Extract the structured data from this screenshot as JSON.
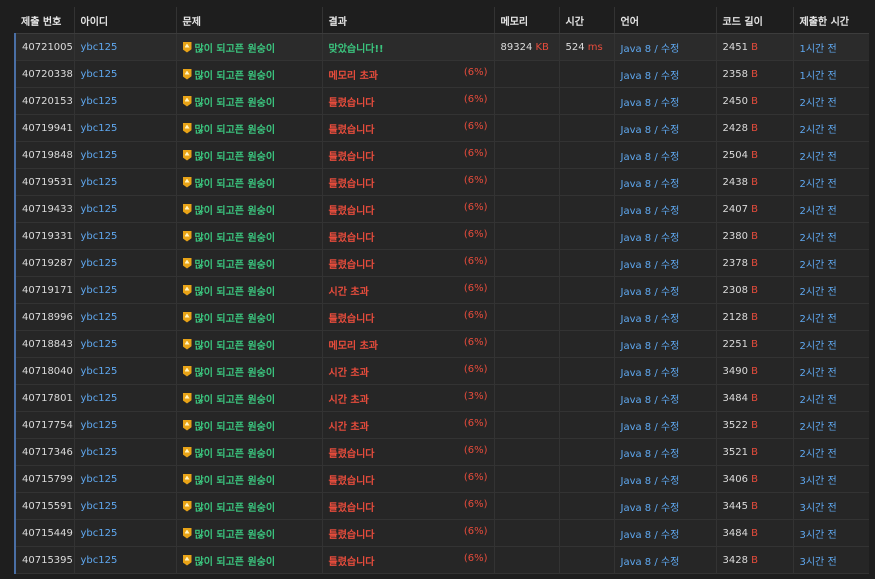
{
  "headers": [
    "제출 번호",
    "아이디",
    "문제",
    "결과",
    "메모리",
    "시간",
    "언어",
    "코드 길이",
    "제출한 시간"
  ],
  "units": {
    "memory": "KB",
    "time": "ms",
    "code": "B"
  },
  "rows": [
    {
      "id": "40721005",
      "user": "ybc125",
      "problem": "많이 되고픈 원숭이",
      "result": "맞았습니다!!",
      "pct": "",
      "ok": true,
      "memory": "89324",
      "time": "524",
      "lang": "Java 8",
      "edit": "수정",
      "length": "2451",
      "when": "1시간 전"
    },
    {
      "id": "40720338",
      "user": "ybc125",
      "problem": "많이 되고픈 원숭이",
      "result": "메모리 초과",
      "pct": "(6%)",
      "ok": false,
      "memory": "",
      "time": "",
      "lang": "Java 8",
      "edit": "수정",
      "length": "2358",
      "when": "1시간 전"
    },
    {
      "id": "40720153",
      "user": "ybc125",
      "problem": "많이 되고픈 원숭이",
      "result": "틀렸습니다",
      "pct": "(6%)",
      "ok": false,
      "memory": "",
      "time": "",
      "lang": "Java 8",
      "edit": "수정",
      "length": "2450",
      "when": "2시간 전"
    },
    {
      "id": "40719941",
      "user": "ybc125",
      "problem": "많이 되고픈 원숭이",
      "result": "틀렸습니다",
      "pct": "(6%)",
      "ok": false,
      "memory": "",
      "time": "",
      "lang": "Java 8",
      "edit": "수정",
      "length": "2428",
      "when": "2시간 전"
    },
    {
      "id": "40719848",
      "user": "ybc125",
      "problem": "많이 되고픈 원숭이",
      "result": "틀렸습니다",
      "pct": "(6%)",
      "ok": false,
      "memory": "",
      "time": "",
      "lang": "Java 8",
      "edit": "수정",
      "length": "2504",
      "when": "2시간 전"
    },
    {
      "id": "40719531",
      "user": "ybc125",
      "problem": "많이 되고픈 원숭이",
      "result": "틀렸습니다",
      "pct": "(6%)",
      "ok": false,
      "memory": "",
      "time": "",
      "lang": "Java 8",
      "edit": "수정",
      "length": "2438",
      "when": "2시간 전"
    },
    {
      "id": "40719433",
      "user": "ybc125",
      "problem": "많이 되고픈 원숭이",
      "result": "틀렸습니다",
      "pct": "(6%)",
      "ok": false,
      "memory": "",
      "time": "",
      "lang": "Java 8",
      "edit": "수정",
      "length": "2407",
      "when": "2시간 전"
    },
    {
      "id": "40719331",
      "user": "ybc125",
      "problem": "많이 되고픈 원숭이",
      "result": "틀렸습니다",
      "pct": "(6%)",
      "ok": false,
      "memory": "",
      "time": "",
      "lang": "Java 8",
      "edit": "수정",
      "length": "2380",
      "when": "2시간 전"
    },
    {
      "id": "40719287",
      "user": "ybc125",
      "problem": "많이 되고픈 원숭이",
      "result": "틀렸습니다",
      "pct": "(6%)",
      "ok": false,
      "memory": "",
      "time": "",
      "lang": "Java 8",
      "edit": "수정",
      "length": "2378",
      "when": "2시간 전"
    },
    {
      "id": "40719171",
      "user": "ybc125",
      "problem": "많이 되고픈 원숭이",
      "result": "시간 초과",
      "pct": "(6%)",
      "ok": false,
      "memory": "",
      "time": "",
      "lang": "Java 8",
      "edit": "수정",
      "length": "2308",
      "when": "2시간 전"
    },
    {
      "id": "40718996",
      "user": "ybc125",
      "problem": "많이 되고픈 원숭이",
      "result": "틀렸습니다",
      "pct": "(6%)",
      "ok": false,
      "memory": "",
      "time": "",
      "lang": "Java 8",
      "edit": "수정",
      "length": "2128",
      "when": "2시간 전"
    },
    {
      "id": "40718843",
      "user": "ybc125",
      "problem": "많이 되고픈 원숭이",
      "result": "메모리 초과",
      "pct": "(6%)",
      "ok": false,
      "memory": "",
      "time": "",
      "lang": "Java 8",
      "edit": "수정",
      "length": "2251",
      "when": "2시간 전"
    },
    {
      "id": "40718040",
      "user": "ybc125",
      "problem": "많이 되고픈 원숭이",
      "result": "시간 초과",
      "pct": "(6%)",
      "ok": false,
      "memory": "",
      "time": "",
      "lang": "Java 8",
      "edit": "수정",
      "length": "3490",
      "when": "2시간 전"
    },
    {
      "id": "40717801",
      "user": "ybc125",
      "problem": "많이 되고픈 원숭이",
      "result": "시간 초과",
      "pct": "(3%)",
      "ok": false,
      "memory": "",
      "time": "",
      "lang": "Java 8",
      "edit": "수정",
      "length": "3484",
      "when": "2시간 전"
    },
    {
      "id": "40717754",
      "user": "ybc125",
      "problem": "많이 되고픈 원숭이",
      "result": "시간 초과",
      "pct": "(6%)",
      "ok": false,
      "memory": "",
      "time": "",
      "lang": "Java 8",
      "edit": "수정",
      "length": "3522",
      "when": "2시간 전"
    },
    {
      "id": "40717346",
      "user": "ybc125",
      "problem": "많이 되고픈 원숭이",
      "result": "틀렸습니다",
      "pct": "(6%)",
      "ok": false,
      "memory": "",
      "time": "",
      "lang": "Java 8",
      "edit": "수정",
      "length": "3521",
      "when": "2시간 전"
    },
    {
      "id": "40715799",
      "user": "ybc125",
      "problem": "많이 되고픈 원숭이",
      "result": "틀렸습니다",
      "pct": "(6%)",
      "ok": false,
      "memory": "",
      "time": "",
      "lang": "Java 8",
      "edit": "수정",
      "length": "3406",
      "when": "3시간 전"
    },
    {
      "id": "40715591",
      "user": "ybc125",
      "problem": "많이 되고픈 원숭이",
      "result": "틀렸습니다",
      "pct": "(6%)",
      "ok": false,
      "memory": "",
      "time": "",
      "lang": "Java 8",
      "edit": "수정",
      "length": "3445",
      "when": "3시간 전"
    },
    {
      "id": "40715449",
      "user": "ybc125",
      "problem": "많이 되고픈 원숭이",
      "result": "틀렸습니다",
      "pct": "(6%)",
      "ok": false,
      "memory": "",
      "time": "",
      "lang": "Java 8",
      "edit": "수정",
      "length": "3484",
      "when": "3시간 전"
    },
    {
      "id": "40715395",
      "user": "ybc125",
      "problem": "많이 되고픈 원숭이",
      "result": "틀렸습니다",
      "pct": "(6%)",
      "ok": false,
      "memory": "",
      "time": "",
      "lang": "Java 8",
      "edit": "수정",
      "length": "3428",
      "when": "3시간 전"
    }
  ]
}
